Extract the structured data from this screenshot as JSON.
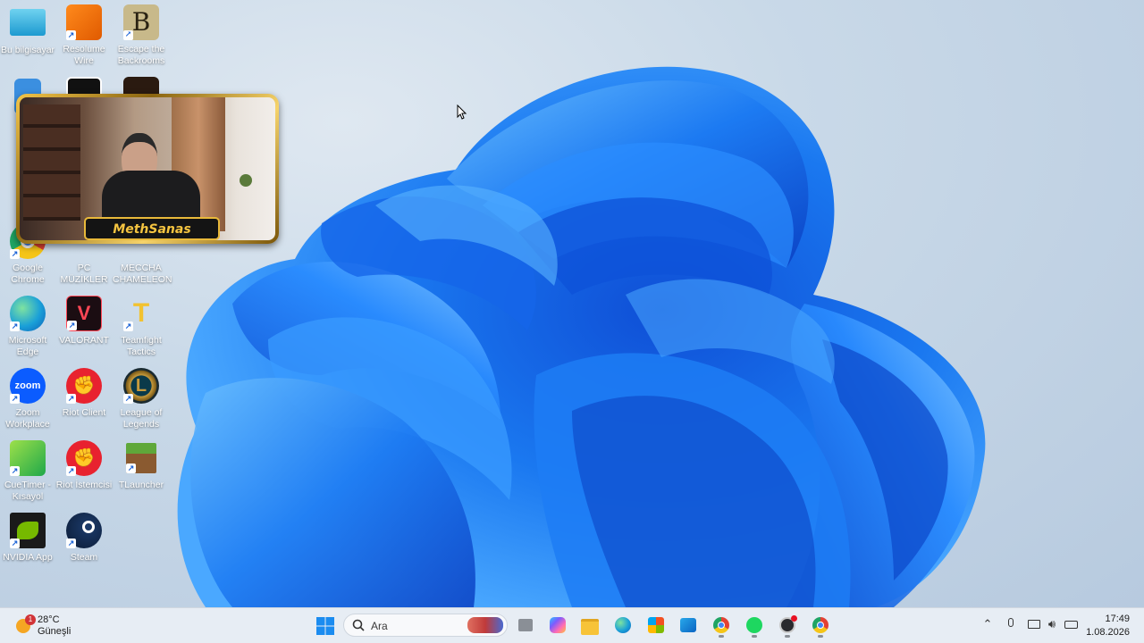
{
  "desktop_icons": [
    {
      "label": "Bu bilgisayar"
    },
    {
      "label": "Resolume Wire"
    },
    {
      "label": "Escape the Backrooms"
    },
    {
      "label": "Google Chrome"
    },
    {
      "label": "PC MÜZİKLER"
    },
    {
      "label": "MECCHA CHAMELEON"
    },
    {
      "label": "Microsoft Edge"
    },
    {
      "label": "VALORANT"
    },
    {
      "label": "Teamfight Tactics"
    },
    {
      "label": "Zoom Workplace"
    },
    {
      "label": "Riot Client"
    },
    {
      "label": "League of Legends"
    },
    {
      "label": "CueTimer - Kısayol"
    },
    {
      "label": "Riot İstemcisi"
    },
    {
      "label": "TLauncher"
    },
    {
      "label": "NVIDIA App"
    },
    {
      "label": "Steam"
    }
  ],
  "webcam": {
    "streamer_name": "MethSanas"
  },
  "taskbar": {
    "weather_temp": "28°C",
    "weather_desc": "Güneşli",
    "weather_badge": "1",
    "search_placeholder": "Ara",
    "time": "17:49",
    "date": "1.08.2026",
    "pinned_apps": [
      "start",
      "search",
      "task-view",
      "copilot",
      "file-explorer",
      "edge",
      "store",
      "outlook",
      "chrome",
      "spotify",
      "obs",
      "chrome-profile"
    ]
  },
  "colors": {
    "wallpaper_blue": "#1a6ff0",
    "taskbar_bg": "#e7edf4",
    "webcam_gold": "#e9b93a"
  }
}
